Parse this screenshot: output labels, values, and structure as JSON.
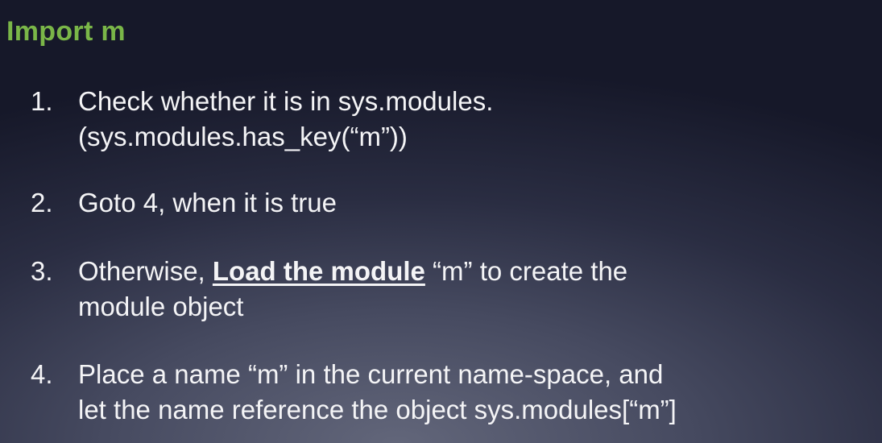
{
  "slide": {
    "title": "Import m",
    "colors": {
      "title": "#7ab648",
      "text": "#f4f4f6",
      "background": "#2a2d42"
    },
    "steps": [
      {
        "number": "1.",
        "line1": "Check whether it is in sys.modules.",
        "line2": "(sys.modules.has_key(“m”))"
      },
      {
        "number": "2.",
        "line1": "Goto 4, when it is true"
      },
      {
        "number": "3.",
        "line1_before": "Otherwise, ",
        "line1_emphasis": "Load the module",
        "line1_after": " “m” to create the",
        "line2": "module object"
      },
      {
        "number": "4.",
        "line1": "Place a name “m” in the current name-space, and",
        "line2": "let the name reference the object sys.modules[“m”]"
      }
    ]
  }
}
